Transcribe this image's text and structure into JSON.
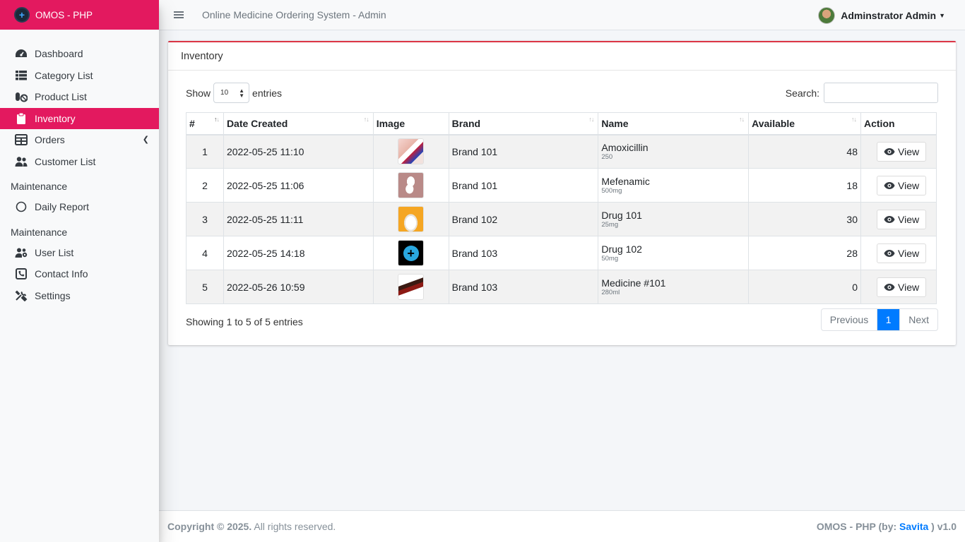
{
  "brand": {
    "name": "OMOS - PHP"
  },
  "sidebar": {
    "items": [
      {
        "label": "Dashboard",
        "icon": "dashboard-icon"
      },
      {
        "label": "Category List",
        "icon": "list-icon"
      },
      {
        "label": "Product List",
        "icon": "pills-icon"
      },
      {
        "label": "Inventory",
        "icon": "clipboard-icon",
        "active": true
      },
      {
        "label": "Orders",
        "icon": "table-icon"
      },
      {
        "label": "Customer List",
        "icon": "users-icon"
      }
    ],
    "section1": "Maintenance",
    "report": {
      "label": "Daily Report",
      "icon": "circle-icon"
    },
    "section2": "Maintenance",
    "maint": [
      {
        "label": "User List",
        "icon": "users-cog-icon"
      },
      {
        "label": "Contact Info",
        "icon": "phone-square-icon"
      },
      {
        "label": "Settings",
        "icon": "tools-icon"
      }
    ]
  },
  "topbar": {
    "title": "Online Medicine Ordering System - Admin",
    "user": "Adminstrator Admin"
  },
  "card": {
    "title": "Inventory"
  },
  "table": {
    "show_label": "Show",
    "entries_label": "entries",
    "page_size": "10",
    "search_label": "Search:",
    "headers": [
      "#",
      "Date Created",
      "Image",
      "Brand",
      "Name",
      "Available",
      "Action"
    ],
    "rows": [
      {
        "num": "1",
        "date": "2022-05-25 11:10",
        "brand": "Brand 101",
        "name": "Amoxicillin",
        "sub": "250",
        "available": "48",
        "action": "View"
      },
      {
        "num": "2",
        "date": "2022-05-25 11:06",
        "brand": "Brand 101",
        "name": "Mefenamic",
        "sub": "500mg",
        "available": "18",
        "action": "View"
      },
      {
        "num": "3",
        "date": "2022-05-25 11:11",
        "brand": "Brand 102",
        "name": "Drug 101",
        "sub": "25mg",
        "available": "30",
        "action": "View"
      },
      {
        "num": "4",
        "date": "2022-05-25 14:18",
        "brand": "Brand 103",
        "name": "Drug 102",
        "sub": "50mg",
        "available": "28",
        "action": "View"
      },
      {
        "num": "5",
        "date": "2022-05-26 10:59",
        "brand": "Brand 103",
        "name": "Medicine #101",
        "sub": "280ml",
        "available": "0",
        "action": "View"
      }
    ],
    "info": "Showing 1 to 5 of 5 entries",
    "prev": "Previous",
    "page": "1",
    "next": "Next"
  },
  "footer": {
    "copyright": "Copyright © 2025.",
    "rights": " All rights reserved.",
    "app": "OMOS - PHP (by: ",
    "author": "Savita",
    "version": " ) v1.0"
  },
  "colors": {
    "accent": "#e3195f",
    "primary": "#007bff",
    "card_border": "#dc3545"
  }
}
